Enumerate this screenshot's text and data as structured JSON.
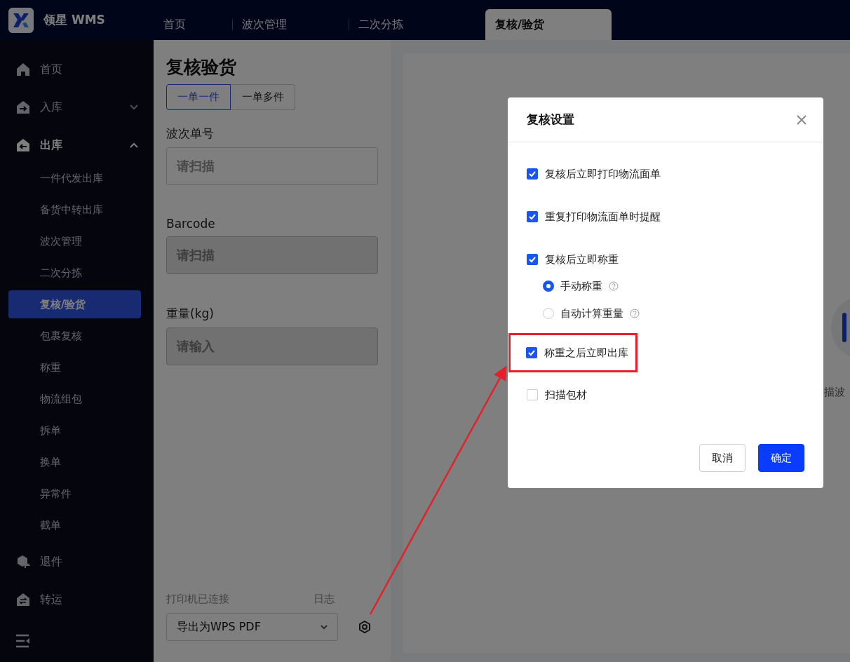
{
  "app": {
    "name": "领星 WMS"
  },
  "tabs": [
    {
      "label": "首页",
      "selected": false
    },
    {
      "label": "波次管理",
      "selected": false
    },
    {
      "label": "二次分拣",
      "selected": false
    },
    {
      "label": "复核/验货",
      "selected": true
    }
  ],
  "sidebar": {
    "items": [
      {
        "label": "首页"
      },
      {
        "label": "入库",
        "expanded": false
      },
      {
        "label": "出库",
        "expanded": true,
        "children": [
          {
            "label": "一件代发出库",
            "selected": false
          },
          {
            "label": "备货中转出库",
            "selected": false
          },
          {
            "label": "波次管理",
            "selected": false
          },
          {
            "label": "二次分拣",
            "selected": false
          },
          {
            "label": "复核/验货",
            "selected": true
          },
          {
            "label": "包裹复核",
            "selected": false
          },
          {
            "label": "称重",
            "selected": false
          },
          {
            "label": "物流组包",
            "selected": false
          },
          {
            "label": "拆单",
            "selected": false
          },
          {
            "label": "换单",
            "selected": false
          },
          {
            "label": "异常件",
            "selected": false
          },
          {
            "label": "截单",
            "selected": false
          }
        ]
      },
      {
        "label": "退件"
      },
      {
        "label": "转运"
      }
    ]
  },
  "panel": {
    "title": "复核验货",
    "modes": [
      {
        "label": "一单一件",
        "selected": true
      },
      {
        "label": "一单多件",
        "selected": false
      }
    ],
    "fields": [
      {
        "label": "波次单号",
        "placeholder": "请扫描",
        "disabled": false
      },
      {
        "label": "Barcode",
        "placeholder": "请扫描",
        "disabled": true
      },
      {
        "label": "重量(kg)",
        "placeholder": "请输入",
        "disabled": true
      }
    ],
    "printer_status": "打印机已连接",
    "log_link": "日志",
    "printer_select": {
      "value": "导出为WPS PDF"
    }
  },
  "right_card": {
    "prompt": "描波"
  },
  "dialog": {
    "title": "复核设置",
    "options": [
      {
        "kind": "checkbox",
        "label": "复核后立即打印物流面单",
        "checked": true,
        "highlighted": false
      },
      {
        "kind": "checkbox",
        "label": "重复打印物流面单时提醒",
        "checked": true,
        "highlighted": false
      },
      {
        "kind": "checkbox",
        "label": "复核后立即称重",
        "checked": true,
        "highlighted": false,
        "children": [
          {
            "kind": "radio",
            "label": "手动称重",
            "selected": true
          },
          {
            "kind": "radio",
            "label": "自动计算重量",
            "selected": false
          }
        ]
      },
      {
        "kind": "checkbox",
        "label": "称重之后立即出库",
        "checked": true,
        "highlighted": true
      },
      {
        "kind": "checkbox",
        "label": "扫描包材",
        "checked": false,
        "highlighted": false
      }
    ],
    "buttons": [
      {
        "label": "取消",
        "kind": "secondary"
      },
      {
        "label": "确定",
        "kind": "primary"
      }
    ]
  }
}
